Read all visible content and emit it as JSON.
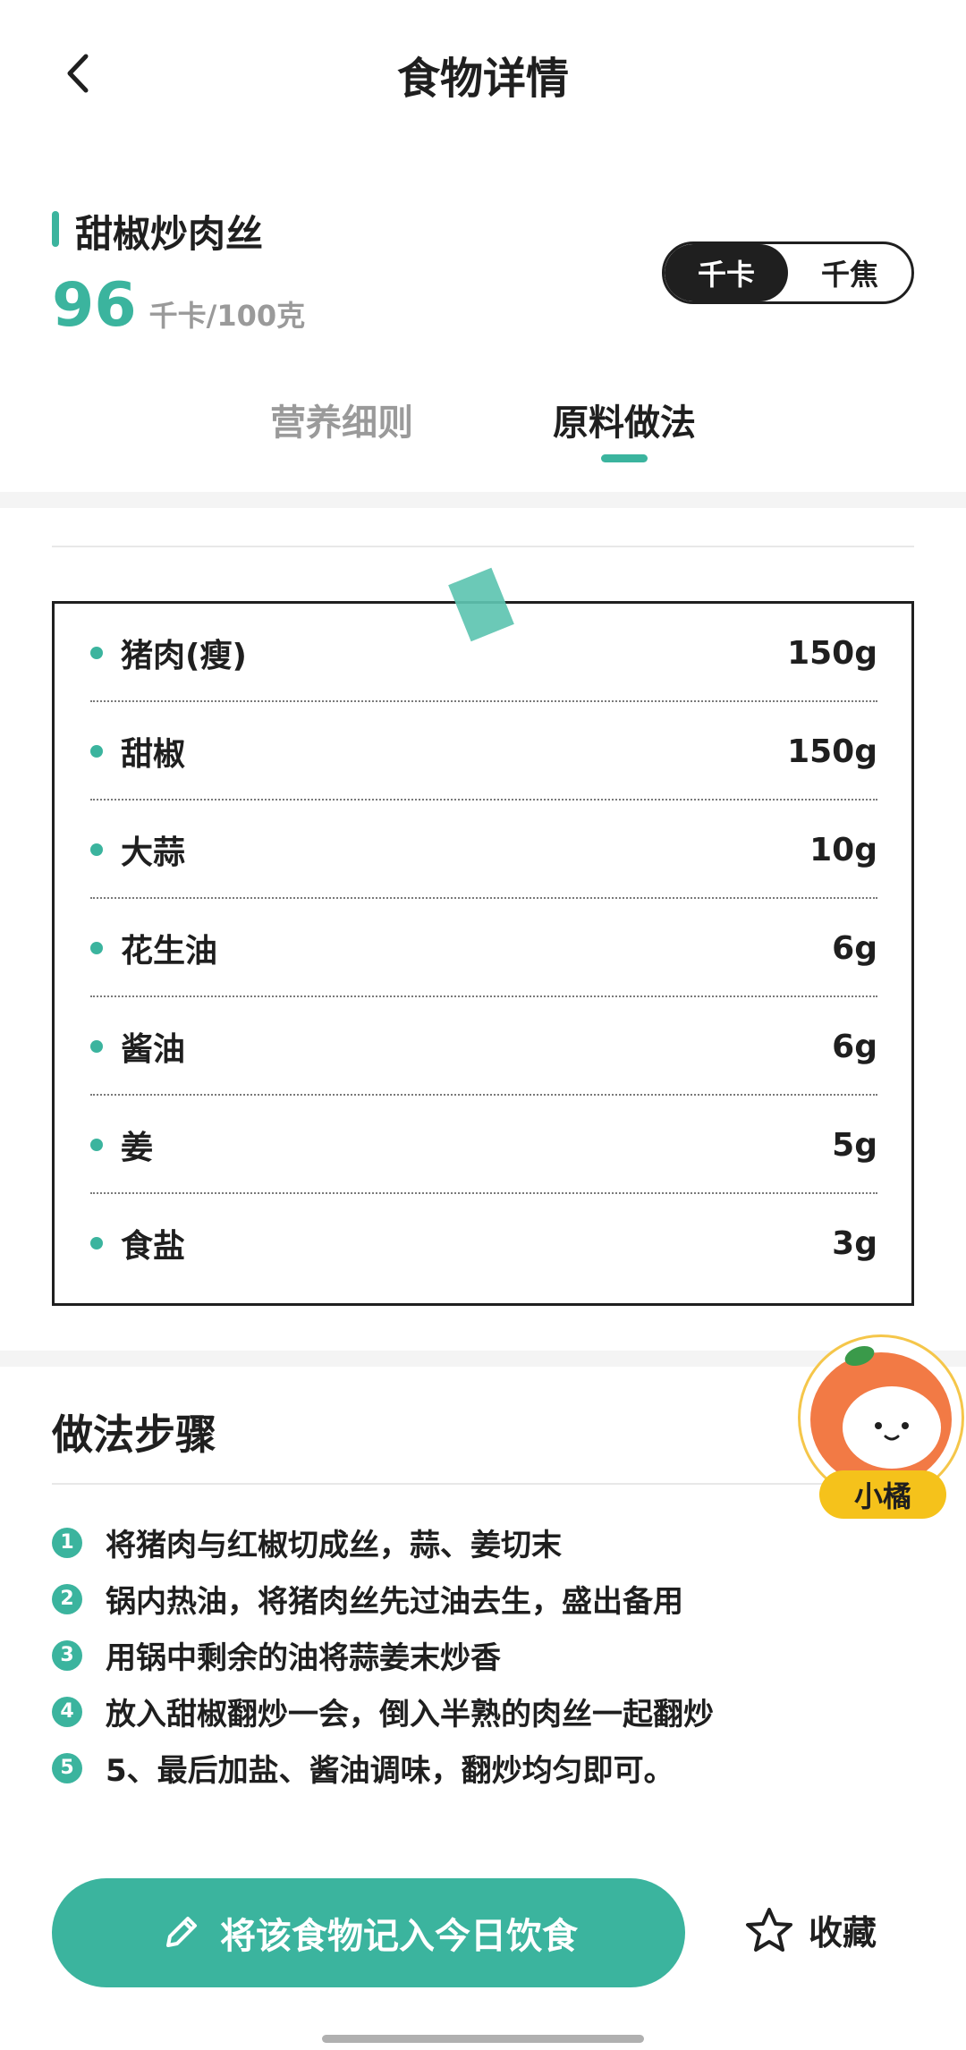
{
  "header": {
    "title": "食物详情",
    "back_icon": "chevron-left-icon"
  },
  "food": {
    "name": "甜椒炒肉丝",
    "calories": "96",
    "calorie_unit": "千卡/100克",
    "accent_color": "#3bb49e"
  },
  "unit_toggle": {
    "options": [
      "千卡",
      "千焦"
    ],
    "selected": "千卡"
  },
  "tabs": [
    {
      "label": "营养细则",
      "active": false
    },
    {
      "label": "原料做法",
      "active": true
    }
  ],
  "ingredients": [
    {
      "name": "猪肉(瘦)",
      "amount": "150g"
    },
    {
      "name": "甜椒",
      "amount": "150g"
    },
    {
      "name": "大蒜",
      "amount": "10g"
    },
    {
      "name": "花生油",
      "amount": "6g"
    },
    {
      "name": "酱油",
      "amount": "6g"
    },
    {
      "name": "姜",
      "amount": "5g"
    },
    {
      "name": "食盐",
      "amount": "3g"
    }
  ],
  "steps": {
    "title": "做法步骤",
    "items": [
      {
        "num": "1",
        "text": "将猪肉与红椒切成丝，蒜、姜切末"
      },
      {
        "num": "2",
        "text": "锅内热油，将猪肉丝先过油去生，盛出备用"
      },
      {
        "num": "3",
        "text": "用锅中剩余的油将蒜姜末炒香"
      },
      {
        "num": "4",
        "text": "放入甜椒翻炒一会，倒入半熟的肉丝一起翻炒"
      },
      {
        "num": "5",
        "text": "5、最后加盐、酱油调味，翻炒均匀即可。"
      }
    ]
  },
  "mascot": {
    "label": "小橘"
  },
  "bottom_bar": {
    "log_label": "将该食物记入今日饮食",
    "log_icon": "pencil-icon",
    "favorite_label": "收藏",
    "favorite_icon": "star-icon"
  }
}
